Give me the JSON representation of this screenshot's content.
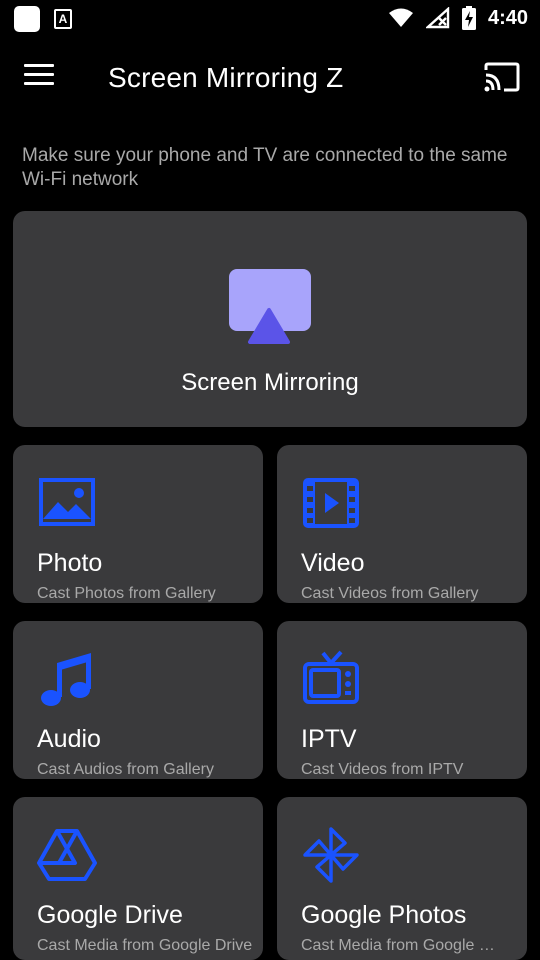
{
  "status_bar": {
    "time": "4:40",
    "font_icon_letter": "A"
  },
  "app_bar": {
    "title": "Screen Mirroring Z"
  },
  "hint": "Make sure your phone and TV are connected to the same Wi-Fi network",
  "hero": {
    "label": "Screen Mirroring",
    "icon": "airplay-icon"
  },
  "tiles": [
    {
      "title": "Photo",
      "subtitle": "Cast Photos from Gallery",
      "icon": "photo-icon"
    },
    {
      "title": "Video",
      "subtitle": "Cast Videos from Gallery",
      "icon": "video-icon"
    },
    {
      "title": "Audio",
      "subtitle": "Cast Audios from Gallery",
      "icon": "music-note-icon"
    },
    {
      "title": "IPTV",
      "subtitle": "Cast Videos from IPTV",
      "icon": "tv-icon"
    },
    {
      "title": "Google Drive",
      "subtitle": "Cast Media from Google Drive",
      "icon": "google-drive-icon"
    },
    {
      "title": "Google Photos",
      "subtitle": "Cast Media from Google …",
      "icon": "pinwheel-icon"
    }
  ],
  "colors": {
    "background": "#000000",
    "card": "#3a3a3c",
    "accent_blue": "#1a53ff",
    "hero_icon_light": "#a8a4fb",
    "hero_icon_dark": "#5b54e8",
    "secondary_text": "#a9a9a9"
  }
}
